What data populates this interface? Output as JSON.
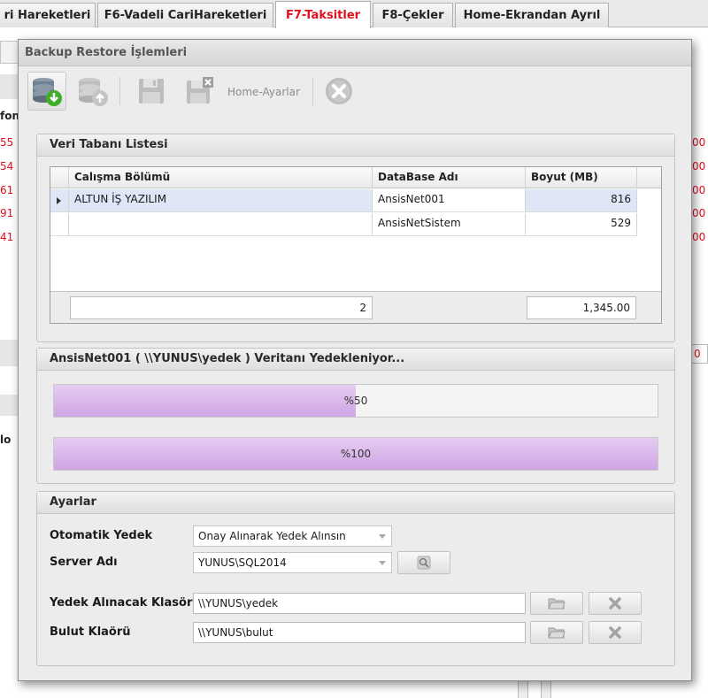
{
  "top_tabs": [
    {
      "label": "ri Hareketleri"
    },
    {
      "label": "F6-Vadeli CariHareketleri"
    },
    {
      "label": "F7-Taksitler"
    },
    {
      "label": "F8-Çekler"
    },
    {
      "label": "Home-Ekrandan Ayrıl"
    }
  ],
  "background": {
    "left_header": "fon",
    "left_numbers": [
      "55",
      "54",
      "61",
      "91",
      "41"
    ],
    "left_label2": "lo",
    "right_numbers": [
      "00",
      "00",
      "00",
      "00",
      "00"
    ],
    "right_box": "0"
  },
  "dialog": {
    "title": "Backup Restore İşlemleri",
    "toolbar": {
      "settings_label": "Home-Ayarlar",
      "icons": [
        "database-backup-icon",
        "database-restore-icon",
        "save-icon",
        "save-cancel-icon",
        "close-circle-icon"
      ]
    },
    "db_list": {
      "title": "Veri Tabanı Listesi",
      "columns": [
        "Calışma Bölümü",
        "DataBase Adı",
        "Boyut (MB)"
      ],
      "rows": [
        {
          "section": "ALTUN İŞ YAZILIM",
          "database": "AnsisNet001",
          "size": "816"
        },
        {
          "section": "",
          "database": "AnsisNetSistem",
          "size": "529"
        }
      ],
      "footer_count": "2",
      "footer_total": "1,345.00"
    },
    "progress": {
      "title": "AnsisNet001 ( \\\\YUNUS\\yedek ) Veritanı Yedekleniyor...",
      "bar1_label": "%50",
      "bar1_value": 50,
      "bar2_label": "%100",
      "bar2_value": 100
    },
    "settings": {
      "title": "Ayarlar",
      "auto_backup_label": "Otomatik Yedek",
      "auto_backup_value": "Onay Alınarak Yedek Alınsın",
      "server_label": "Server Adı",
      "server_value": "YUNUS\\SQL2014",
      "backup_folder_label": "Yedek Alınacak Klasör",
      "backup_folder_value": "\\\\YUNUS\\yedek",
      "cloud_folder_label": "Bulut Klaörü",
      "cloud_folder_value": "\\\\YUNUS\\bulut"
    }
  },
  "colors": {
    "active_tab": "#e0101e",
    "progress_fill": "#d6b0e8",
    "selected_row": "#dfe7f6"
  }
}
